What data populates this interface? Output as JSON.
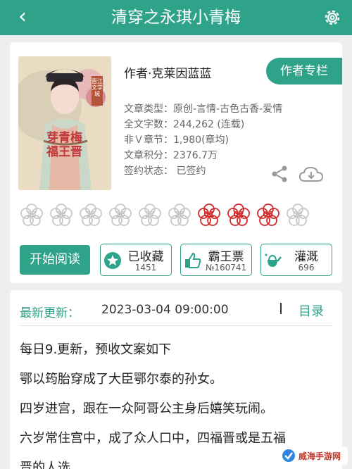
{
  "header": {
    "back_icon": "back-chevron-icon",
    "title": "清穿之永琪小青梅",
    "settings_icon": "gear-icon"
  },
  "book": {
    "cover_title": "芽青梅 福王晋",
    "cover_badge": "晋江文学城",
    "author_label": "作者·克莱因蓝蓝",
    "author_column": "作者专栏",
    "meta": [
      "文章类型：原创-言情-古色古香-爱情",
      "全文字数：244,262 (连载)",
      "非Ｖ章节：1,980(章均)",
      "文章积分：2376.7万",
      "签约状态：  已签约"
    ]
  },
  "flowers": {
    "items": [
      "23",
      "24",
      "25",
      "26",
      "27",
      "28",
      "01",
      "02",
      "03",
      "04"
    ],
    "highlighted": [
      "01",
      "02",
      "03"
    ],
    "red": "#d02b2b",
    "grey": "#c8c8c8"
  },
  "actions": {
    "read": "开始阅读",
    "favorite": {
      "label": "已收藏",
      "count": "1451"
    },
    "bawang": {
      "label": "霸王票",
      "count": "№160741"
    },
    "irrigate": {
      "label": "灌溉",
      "count": "696"
    }
  },
  "update": {
    "label": "最新更新：",
    "time": "2023-03-04 09:00:00",
    "toc": "目录"
  },
  "content_lines": [
    "每日9.更新，预收文案如下",
    "鄂以筠胎穿成了大臣鄂尔泰的孙女。",
    "四岁进宫，跟在一众阿哥公主身后嬉笑玩闹。",
    "六岁常住宫中，成了众人口中，四福晋或是五福",
    "晋的人选"
  ],
  "watermark": "威海手游网",
  "colors": {
    "accent": "#2fa28a"
  }
}
